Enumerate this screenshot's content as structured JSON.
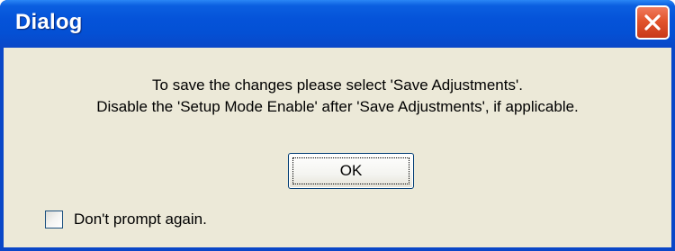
{
  "window": {
    "title": "Dialog",
    "close_icon": "close-icon"
  },
  "message": {
    "line1": "To save the changes please select 'Save Adjustments'.",
    "line2": "Disable the 'Setup Mode Enable' after 'Save Adjustments', if applicable."
  },
  "buttons": {
    "ok_label": "OK"
  },
  "checkbox": {
    "label": "Don't prompt again.",
    "checked": false
  },
  "colors": {
    "titlebar": "#0553d9",
    "client_background": "#ece9d8",
    "close_button": "#e2542c"
  }
}
